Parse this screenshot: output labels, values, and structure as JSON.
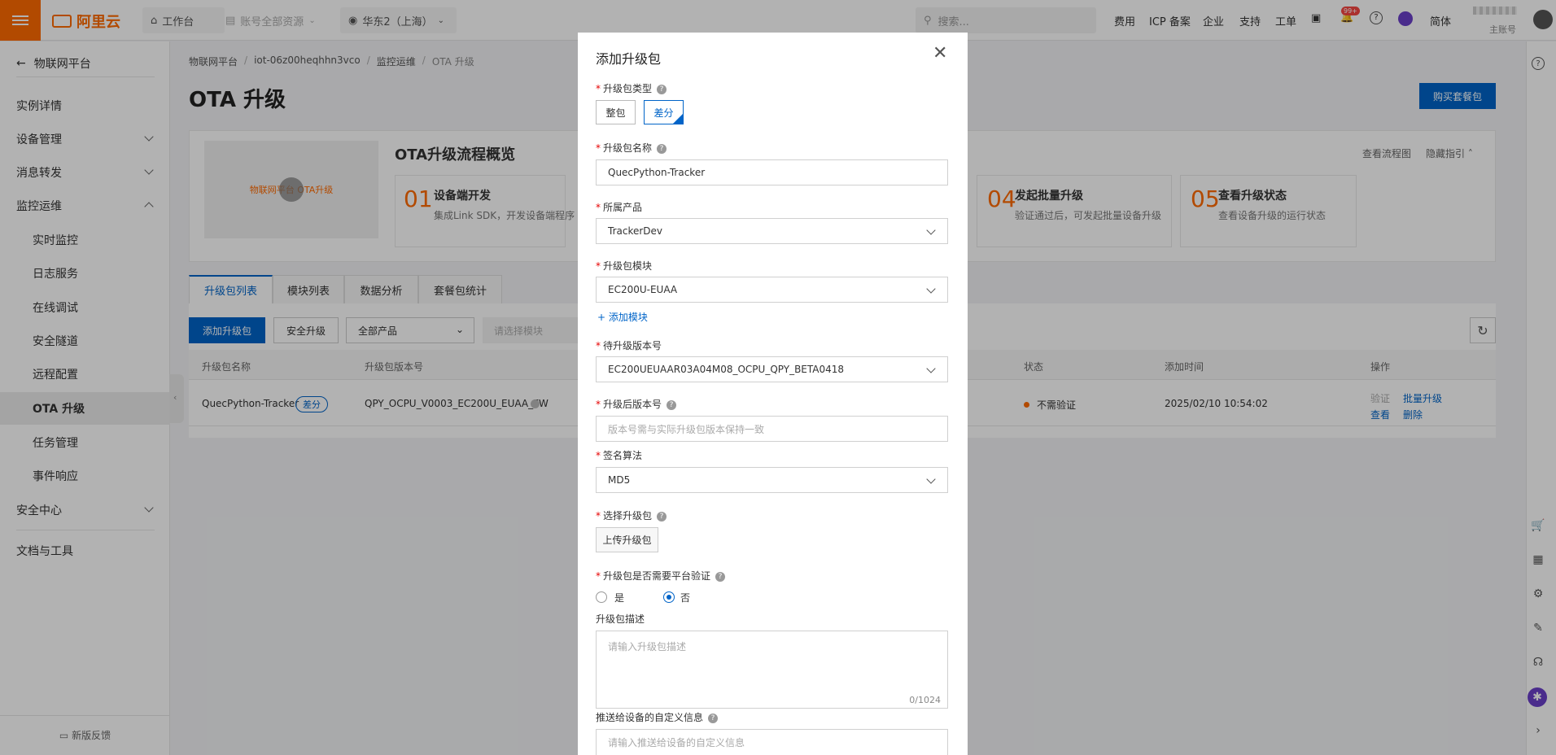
{
  "topbar": {
    "logo_text": "阿里云",
    "workbench": "工作台",
    "account_scope": "账号全部资源",
    "region": "华东2（上海）",
    "search_placeholder": "搜索...",
    "nav": [
      "费用",
      "ICP 备案",
      "企业",
      "支持",
      "工单"
    ],
    "notification_badge": "99+",
    "language": "简体",
    "account_label": "主账号",
    "brand_color": "#ff6a00"
  },
  "sidebar": {
    "back_label": "物联网平台",
    "items": [
      {
        "label": "实例详情"
      },
      {
        "label": "设备管理"
      },
      {
        "label": "消息转发"
      },
      {
        "label": "监控运维"
      },
      {
        "label": "实时监控"
      },
      {
        "label": "日志服务"
      },
      {
        "label": "在线调试"
      },
      {
        "label": "安全隧道"
      },
      {
        "label": "远程配置"
      },
      {
        "label": "OTA 升级"
      },
      {
        "label": "任务管理"
      },
      {
        "label": "事件响应"
      },
      {
        "label": "安全中心"
      },
      {
        "label": "文档与工具"
      }
    ],
    "feedback": "新版反馈"
  },
  "main": {
    "breadcrumb": [
      "物联网平台",
      "iot-06z00heqhhn3vco",
      "监控运维",
      "OTA 升级"
    ],
    "page_title": "OTA 升级",
    "buy_button": "购买套餐包",
    "overview": {
      "video_caption": "物联网平台 OTA升级",
      "title": "OTA升级流程概览",
      "view_flow": "查看流程图",
      "hide_guide": "隐藏指引",
      "steps": [
        {
          "num": "01",
          "title": "设备端开发",
          "desc": "集成Link SDK，开发设备端程序"
        },
        {
          "num": "04",
          "title": "发起批量升级",
          "desc": "验证通过后，可发起批量设备升级"
        },
        {
          "num": "05",
          "title": "查看升级状态",
          "desc": "查看设备升级的运行状态"
        }
      ]
    },
    "tabs": [
      "升级包列表",
      "模块列表",
      "数据分析",
      "套餐包统计"
    ],
    "toolbar": {
      "add_package": "添加升级包",
      "secure_upgrade": "安全升级",
      "product_filter": "全部产品",
      "module_filter": "请选择模块"
    },
    "table": {
      "headers": [
        "升级包名称",
        "升级包版本号",
        "状态",
        "添加时间",
        "操作"
      ],
      "rows": [
        {
          "name": "QuecPython-Tracker",
          "tag": "差分",
          "version": "QPY_OCPU_V0003_EC200U_EUAA_FW",
          "status": "不需验证",
          "time": "2025/02/10 10:54:02",
          "actions": [
            "验证",
            "批量升级",
            "查看",
            "删除"
          ]
        }
      ]
    }
  },
  "dialog": {
    "title": "添加升级包",
    "type_label": "升级包类型",
    "type_options": [
      "整包",
      "差分"
    ],
    "type_selected": "差分",
    "name_label": "升级包名称",
    "name_value": "QuecPython-Tracker",
    "product_label": "所属产品",
    "product_value": "TrackerDev",
    "module_label": "升级包模块",
    "module_value": "EC200U-EUAA",
    "add_module": "+ 添加模块",
    "from_version_label": "待升级版本号",
    "from_version_value": "EC200UEUAAR03A04M08_OCPU_QPY_BETA0418",
    "to_version_label": "升级后版本号",
    "to_version_placeholder": "版本号需与实际升级包版本保持一致",
    "algorithm_label": "签名算法",
    "algorithm_value": "MD5",
    "file_label": "选择升级包",
    "upload_button": "上传升级包",
    "verify_label": "升级包是否需要平台验证",
    "verify_yes": "是",
    "verify_no": "否",
    "verify_selected": "否",
    "desc_label": "升级包描述",
    "desc_placeholder": "请输入升级包描述",
    "desc_counter": "0/1024",
    "custom_label": "推送给设备的自定义信息",
    "custom_placeholder": "请输入推送给设备的自定义信息",
    "accent_color": "#0064c8"
  }
}
